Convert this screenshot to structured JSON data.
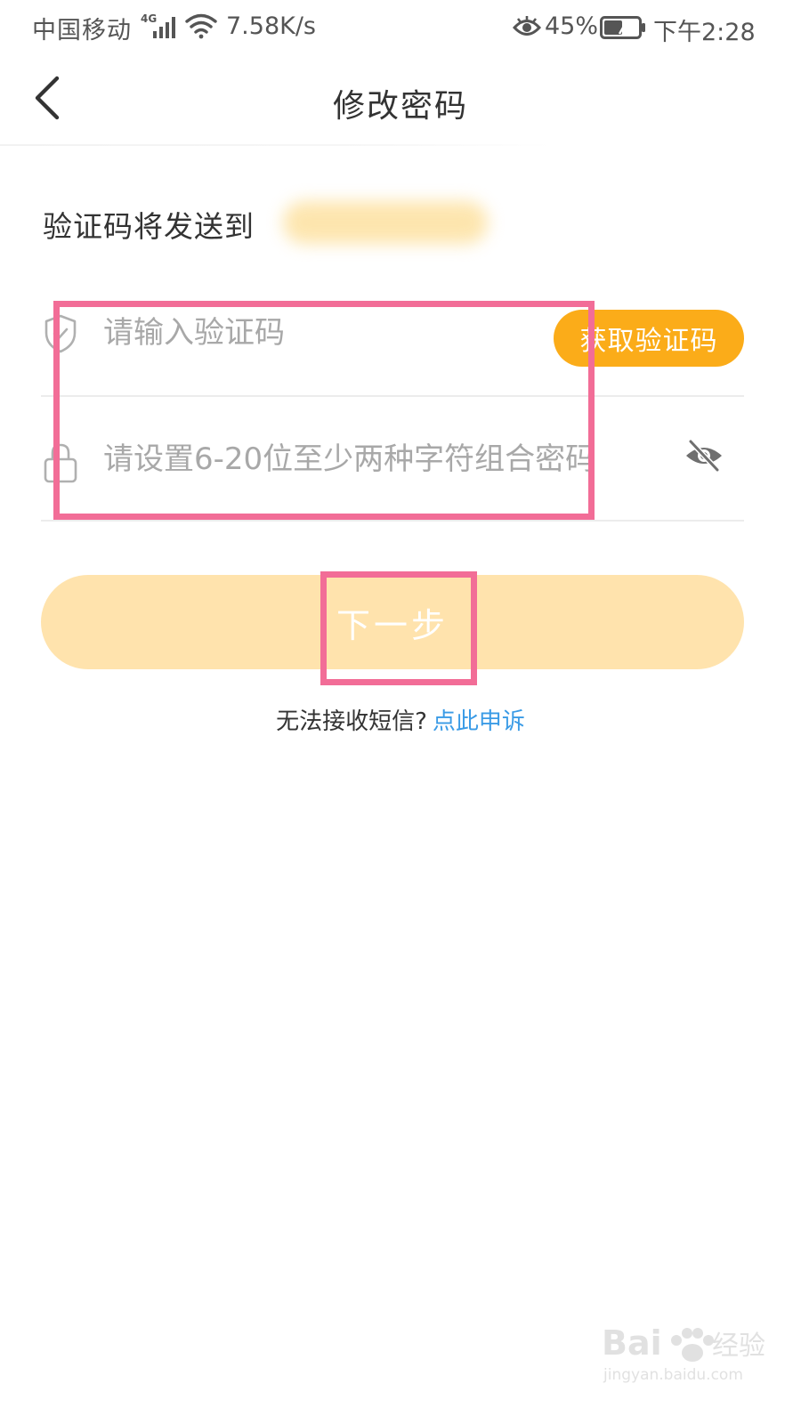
{
  "status_bar": {
    "carrier": "中国移动",
    "network": "4G",
    "speed": "7.58K/s",
    "battery": "45%",
    "time": "下午2:28"
  },
  "nav": {
    "title": "修改密码",
    "back_icon": "chevron-left-icon"
  },
  "send_hint": "验证码将发送到",
  "form": {
    "code": {
      "placeholder": "请输入验证码",
      "value": "",
      "icon": "shield-check-icon",
      "get_code_label": "获取验证码"
    },
    "password": {
      "placeholder": "请设置6-20位至少两种字符组合密码",
      "value": "",
      "icon": "lock-icon",
      "toggle_icon": "eye-off-icon"
    }
  },
  "next_label": "下一步",
  "sms_help": {
    "text": "无法接收短信?",
    "link": "点此申诉"
  },
  "colors": {
    "accent": "#fbac19",
    "button_disabled": "#ffe3ad",
    "link": "#3a9be6",
    "annotation": "#f26d97"
  },
  "watermark": {
    "brand": "Bai",
    "brand_tail": "经验",
    "url": "jingyan.baidu.com"
  }
}
